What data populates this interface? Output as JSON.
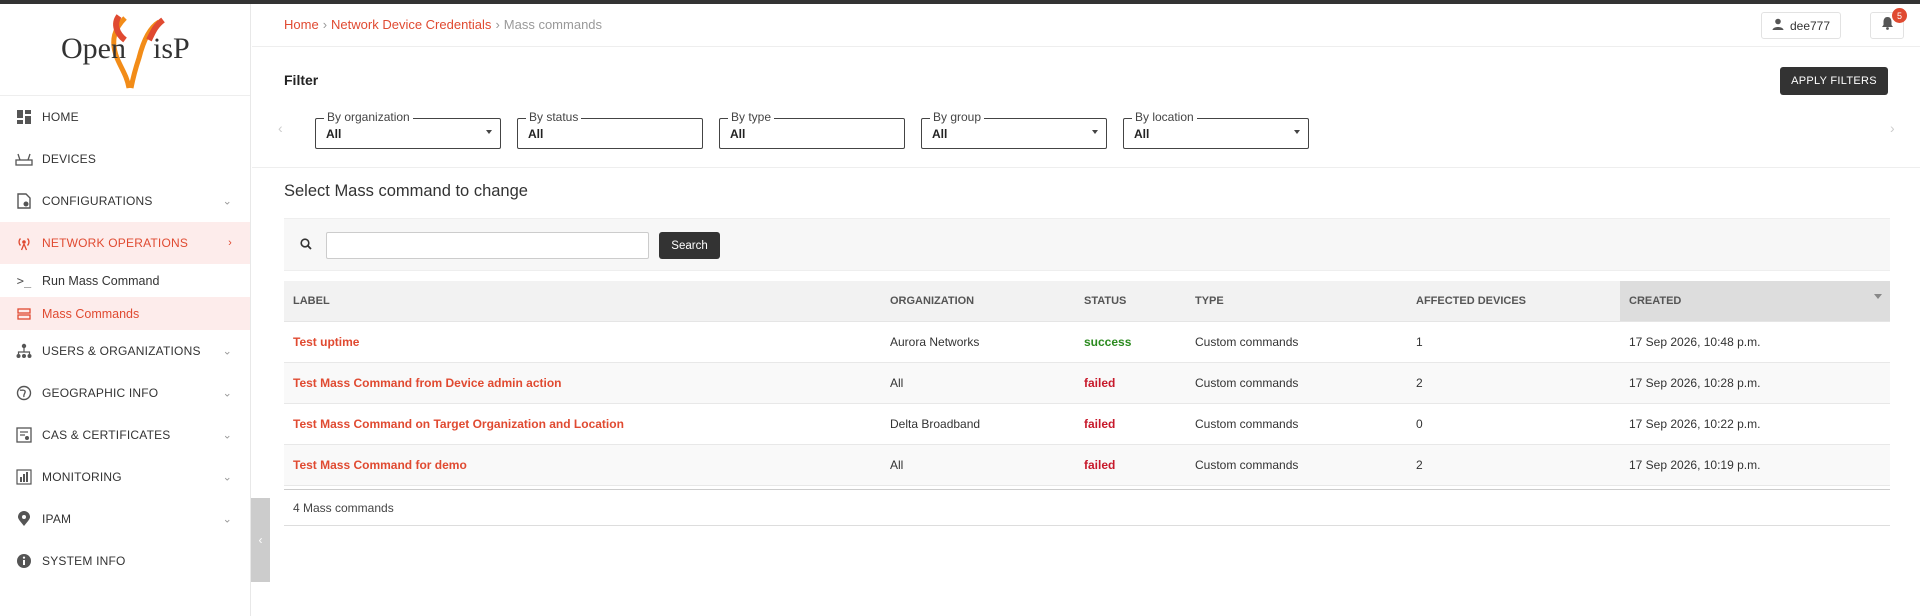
{
  "sidebar": {
    "logo_text": "OpenWisP",
    "items": [
      {
        "label": "HOME",
        "icon": "dashboard-icon"
      },
      {
        "label": "DEVICES",
        "icon": "router-icon"
      },
      {
        "label": "CONFIGURATIONS",
        "icon": "config-file-icon"
      },
      {
        "label": "NETWORK OPERATIONS",
        "icon": "broadcast-icon"
      },
      {
        "label": "Run Mass Command",
        "icon": "terminal-icon"
      },
      {
        "label": "Mass Commands",
        "icon": "stack-icon"
      },
      {
        "label": "USERS & ORGANIZATIONS",
        "icon": "org-tree-icon"
      },
      {
        "label": "GEOGRAPHIC INFO",
        "icon": "globe-icon"
      },
      {
        "label": "CAS & CERTIFICATES",
        "icon": "certificate-icon"
      },
      {
        "label": "MONITORING",
        "icon": "bar-chart-icon"
      },
      {
        "label": "IPAM",
        "icon": "map-pin-icon"
      },
      {
        "label": "SYSTEM INFO",
        "icon": "info-icon"
      }
    ]
  },
  "breadcrumb": {
    "home": "Home",
    "section": "Network Device Credentials",
    "current": "Mass commands"
  },
  "header": {
    "username": "dee777",
    "notification_count": "5"
  },
  "filter": {
    "title": "Filter",
    "apply_label": "APPLY FILTERS",
    "fields": [
      {
        "label": "By organization",
        "value": "All"
      },
      {
        "label": "By status",
        "value": "All"
      },
      {
        "label": "By type",
        "value": "All"
      },
      {
        "label": "By group",
        "value": "All"
      },
      {
        "label": "By location",
        "value": "All"
      }
    ]
  },
  "main": {
    "title": "Select Mass command to change",
    "search_button": "Search",
    "search_value": "",
    "columns": [
      "LABEL",
      "ORGANIZATION",
      "STATUS",
      "TYPE",
      "AFFECTED DEVICES",
      "CREATED"
    ],
    "rows": [
      {
        "label": "Test uptime",
        "organization": "Aurora Networks",
        "status": "success",
        "type": "Custom commands",
        "affected": "1",
        "created": "17 Sep 2026, 10:48 p.m."
      },
      {
        "label": "Test Mass Command from Device admin action",
        "organization": "All",
        "status": "failed",
        "type": "Custom commands",
        "affected": "2",
        "created": "17 Sep 2026, 10:28 p.m."
      },
      {
        "label": "Test Mass Command on Target Organization and Location",
        "organization": "Delta Broadband",
        "status": "failed",
        "type": "Custom commands",
        "affected": "0",
        "created": "17 Sep 2026, 10:22 p.m."
      },
      {
        "label": "Test Mass Command for demo",
        "organization": "All",
        "status": "failed",
        "type": "Custom commands",
        "affected": "2",
        "created": "17 Sep 2026, 10:19 p.m."
      }
    ],
    "result_count": "4 Mass commands"
  },
  "colors": {
    "accent": "#e04a31",
    "success": "#2b8a1f",
    "failed": "#c7192b"
  }
}
